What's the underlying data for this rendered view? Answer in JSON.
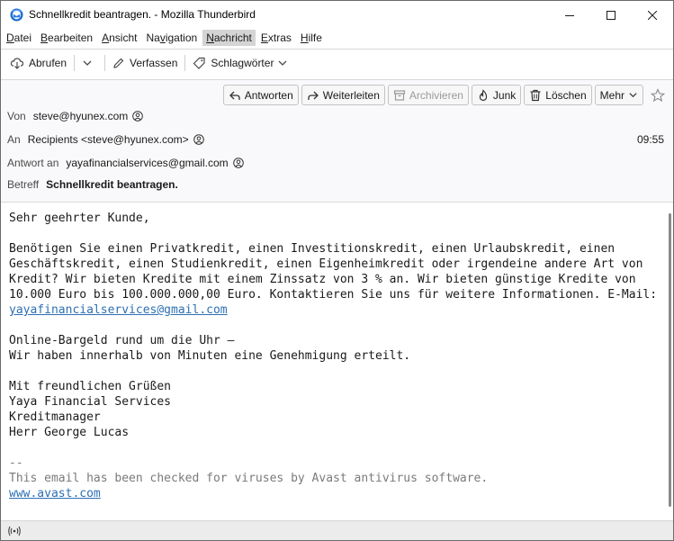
{
  "window": {
    "title": "Schnellkredit beantragen. - Mozilla Thunderbird"
  },
  "menubar": {
    "items": [
      {
        "label": "Datei",
        "underline": "D",
        "rest": "atei"
      },
      {
        "label": "Bearbeiten",
        "underline": "B",
        "rest": "earbeiten"
      },
      {
        "label": "Ansicht",
        "underline": "A",
        "rest": "nsicht"
      },
      {
        "pre": "Na",
        "label": "Navigation",
        "underline": "v",
        "rest": "igation"
      },
      {
        "label": "Nachricht",
        "underline": "N",
        "rest": "achricht"
      },
      {
        "label": "Extras",
        "underline": "E",
        "rest": "xtras"
      },
      {
        "label": "Hilfe",
        "underline": "H",
        "rest": "ilfe"
      }
    ]
  },
  "toolbar": {
    "fetch_label": "Abrufen",
    "compose_label": "Verfassen",
    "tags_label": "Schlagwörter"
  },
  "actions": {
    "reply": "Antworten",
    "forward": "Weiterleiten",
    "archive": "Archivieren",
    "junk": "Junk",
    "delete": "Löschen",
    "more": "Mehr"
  },
  "header": {
    "from_label": "Von",
    "from_value": "steve@hyunex.com",
    "to_label": "An",
    "to_value": "Recipients <steve@hyunex.com>",
    "time": "09:55",
    "reply_to_label": "Antwort an",
    "reply_to_value": "yayafinancialservices@gmail.com",
    "subject_label": "Betreff",
    "subject_value": "Schnellkredit beantragen."
  },
  "body": {
    "greeting": "Sehr geehrter Kunde,",
    "para1": "Benötigen Sie einen Privatkredit, einen Investitionskredit, einen Urlaubskredit, einen Geschäftskredit, einen Studienkredit, einen Eigenheimkredit oder irgendeine andere Art von Kredit? Wir bieten Kredite mit einem Zinssatz von 3 % an. Wir bieten günstige Kredite von 10.000 Euro bis 100.000.000,00 Euro. Kontaktieren Sie uns für weitere Informationen. E-Mail: ",
    "para1_link": "yayafinancialservices@gmail.com",
    "line_online1": "Online-Bargeld rund um die Uhr –",
    "line_online2": "Wir haben innerhalb von Minuten eine Genehmigung erteilt.",
    "closing1": "Mit freundlichen Grüßen",
    "closing2": "Yaya Financial Services",
    "closing3": "Kreditmanager",
    "closing4": "Herr George Lucas",
    "sig_dash": "--",
    "sig_text": "This email has been checked for viruses by Avast antivirus software.",
    "sig_link": "www.avast.com"
  },
  "colors": {
    "link": "#2e6fb3",
    "menu_active_bg": "#d4d4d4",
    "header_bg": "#f9f9fb"
  }
}
